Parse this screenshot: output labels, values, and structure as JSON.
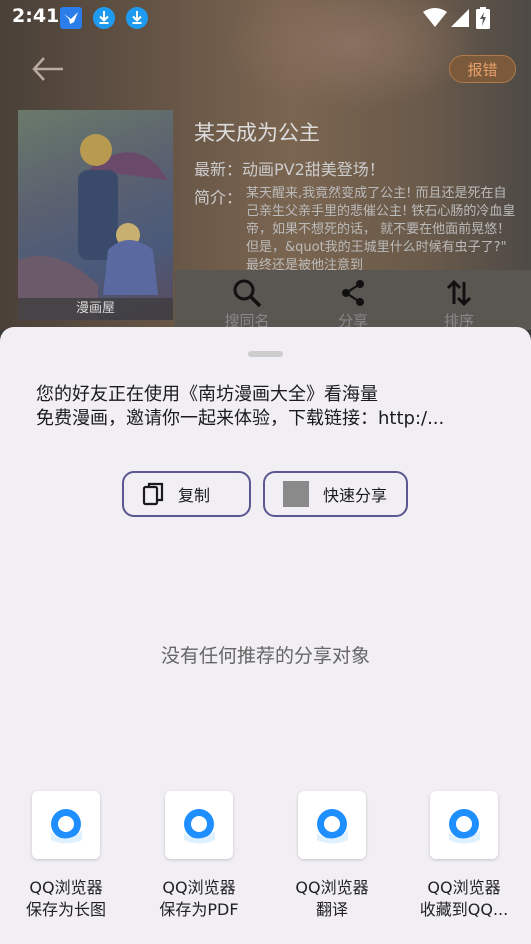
{
  "status_bar": {
    "time": "2:41"
  },
  "background_app": {
    "report_label": "报错",
    "comic_title": "某天成为公主",
    "latest": "最新：动画PV2甜美登场！",
    "intro_label": "简介：",
    "intro_text": "某天醒来,我竟然变成了公主! 而且还是死在自己亲生父亲手里的悲催公主! 铁石心肠的冷血皇帝，如果不想死的话， 就不要在他面前晃悠！ 但是，&quot我的王城里什么时候有虫子了?\" 最终还是被他注意到",
    "cover_watermark": "漫画屋",
    "actions": [
      {
        "label": "搜同名",
        "icon": "search-icon"
      },
      {
        "label": "分享",
        "icon": "share-icon"
      },
      {
        "label": "排序",
        "icon": "sort-icon"
      }
    ]
  },
  "share_sheet": {
    "text_line1": "您的好友正在使用《南坊漫画大全》看海量",
    "text_line2": "免费漫画，邀请你一起来体验，下载链接：http:/...",
    "copy_label": "复制",
    "quick_share_label": "快速分享",
    "empty_message": "没有任何推荐的分享对象",
    "apps": [
      {
        "name": "QQ浏览器",
        "action": "保存为长图"
      },
      {
        "name": "QQ浏览器",
        "action": "保存为PDF"
      },
      {
        "name": "QQ浏览器",
        "action": "翻译"
      },
      {
        "name": "QQ浏览器",
        "action": "收藏到QQ..."
      }
    ]
  },
  "colors": {
    "sheet_background": "#f1eff3",
    "button_border": "#5b5791",
    "report_text": "#e8a06a",
    "qq_browser_blue": "#1f8fff"
  }
}
